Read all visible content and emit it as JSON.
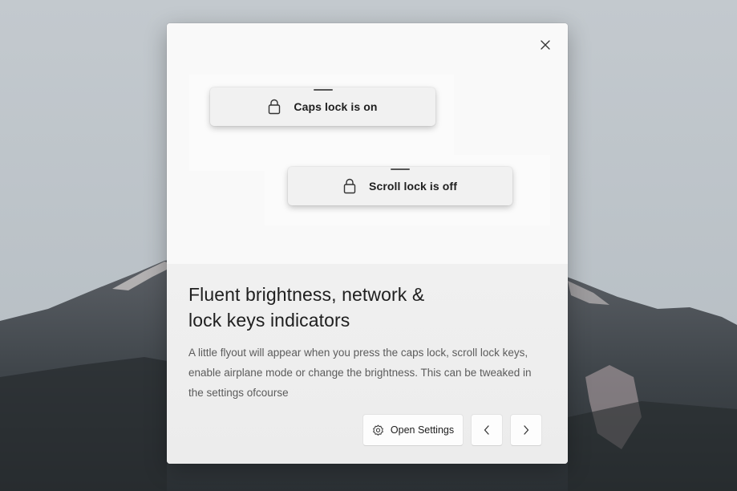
{
  "dialog": {
    "close_icon": "close-icon",
    "flyouts": [
      {
        "icon": "lock-icon",
        "label": "Caps lock is on"
      },
      {
        "icon": "lock-icon",
        "label": "Scroll lock is off"
      }
    ],
    "title_line1": "Fluent brightness, network &",
    "title_line2": "lock keys indicators",
    "description": "A little flyout will appear when you press the caps lock, scroll lock keys, enable airplane mode or change the brightness. This can be tweaked in the settings ofcourse",
    "buttons": {
      "settings_icon": "gear-icon",
      "settings_label": "Open Settings",
      "prev_icon": "chevron-left-icon",
      "next_icon": "chevron-right-icon"
    }
  },
  "colors": {
    "text_primary": "#202020",
    "text_secondary": "#5c5c5c",
    "dialog_background": "#f3f3f3"
  }
}
